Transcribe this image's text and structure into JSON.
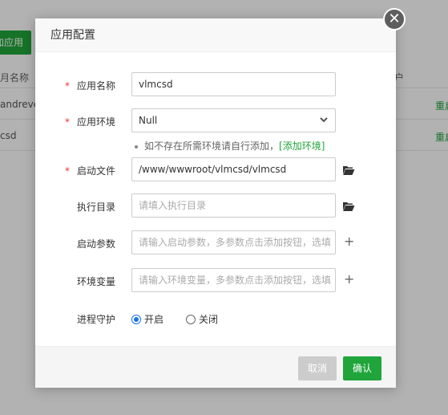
{
  "background": {
    "add_button_label": "加应用",
    "table_head_left": "月名称",
    "table_head_right": "户",
    "rows": [
      {
        "name": "andreve",
        "action": "重启"
      },
      {
        "name": "csd",
        "action": "重启"
      }
    ]
  },
  "dialog": {
    "title": "应用配置",
    "close_glyph": "✕",
    "fields": {
      "app_name": {
        "label": "应用名称",
        "value": "vlmcsd",
        "required": true
      },
      "app_env": {
        "label": "应用环境",
        "value": "Null",
        "required": true
      },
      "start_file": {
        "label": "启动文件",
        "value": "/www/wwwroot/vlmcsd/vlmcsd",
        "required": true
      },
      "exec_dir": {
        "label": "执行目录",
        "placeholder": "请填入执行目录",
        "required": false
      },
      "start_params": {
        "label": "启动参数",
        "placeholder": "请输入启动参数，多参数点击添加按钮，选填",
        "required": false
      },
      "env_vars": {
        "label": "环境变量",
        "placeholder": "请输入环境变量，多参数点击添加按钮，选填",
        "required": false
      }
    },
    "required_mark": "*",
    "hint_text": "如不存在所需环境请自行添加，",
    "hint_link": "[添加环境]",
    "daemon": {
      "label": "进程守护",
      "options": [
        {
          "label": "开启",
          "checked": true
        },
        {
          "label": "关闭",
          "checked": false
        }
      ]
    },
    "buttons": {
      "cancel": "取消",
      "ok": "确认"
    }
  },
  "colors": {
    "accent_green": "#20a53a",
    "required_red": "#ee3333",
    "radio_blue": "#1a73e8"
  }
}
